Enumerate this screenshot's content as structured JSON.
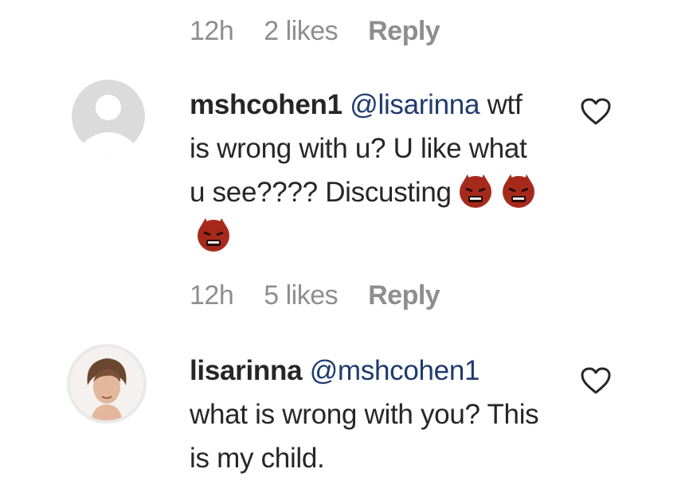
{
  "colors": {
    "meta_gray": "#8e8e8e",
    "text": "#262626",
    "mention": "#1e3a6e",
    "avatar_placeholder": "#dbdbdb"
  },
  "meta_top": {
    "time": "12h",
    "likes": "2 likes",
    "reply": "Reply"
  },
  "comment_1": {
    "username": "mshcohen1",
    "mention": "@lisarinna",
    "text": "wtf is wrong with u? U like what u see???? Discusting",
    "emojis": [
      "angry-devil-icon",
      "angry-devil-icon",
      "angry-devil-icon"
    ],
    "like_icon": "heart-outline-icon"
  },
  "meta_mid": {
    "time": "12h",
    "likes": "5 likes",
    "reply": "Reply"
  },
  "comment_2": {
    "username": "lisarinna",
    "mention": "@mshcohen1",
    "text": "what is wrong with you? This is my child.",
    "like_icon": "heart-outline-icon"
  }
}
